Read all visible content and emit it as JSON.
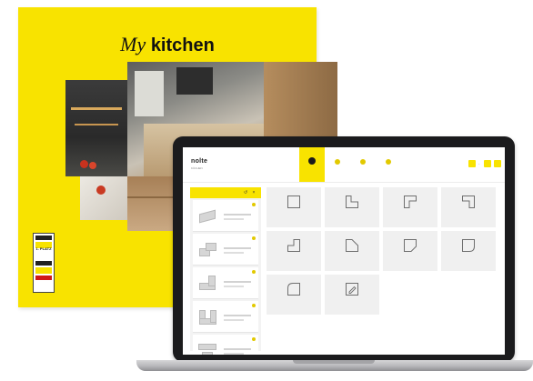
{
  "catalog": {
    "title_italic": "My",
    "title_bold": "kitchen",
    "award_text": "1. PLATZ"
  },
  "app": {
    "logo": "nolte",
    "logo_sub": "KÜCHEN",
    "steps": [
      {
        "label": "",
        "active": true
      },
      {
        "label": "",
        "active": false
      },
      {
        "label": "",
        "active": false
      },
      {
        "label": "",
        "active": false
      }
    ],
    "sidebar": {
      "title": "",
      "items": [
        {
          "name": "",
          "shape": "single"
        },
        {
          "name": "",
          "shape": "stack"
        },
        {
          "name": "",
          "shape": "l"
        },
        {
          "name": "",
          "shape": "u"
        },
        {
          "name": "",
          "shape": "island"
        }
      ]
    },
    "shape_tiles": [
      {
        "label": "",
        "icon": "square"
      },
      {
        "label": "",
        "icon": "l-shape"
      },
      {
        "label": "",
        "icon": "u-corner"
      },
      {
        "label": "",
        "icon": "g-corner"
      },
      {
        "label": "",
        "icon": "l-small"
      },
      {
        "label": "",
        "icon": "diagonal"
      },
      {
        "label": "",
        "icon": "angled"
      },
      {
        "label": "",
        "icon": "rounded"
      },
      {
        "label": "",
        "icon": "rounded-corner"
      },
      {
        "label": "",
        "icon": "edit"
      }
    ]
  },
  "colors": {
    "brand_yellow": "#f8e300",
    "laptop_bezel": "#1b1b1d",
    "tile_bg": "#f0f0f0"
  }
}
